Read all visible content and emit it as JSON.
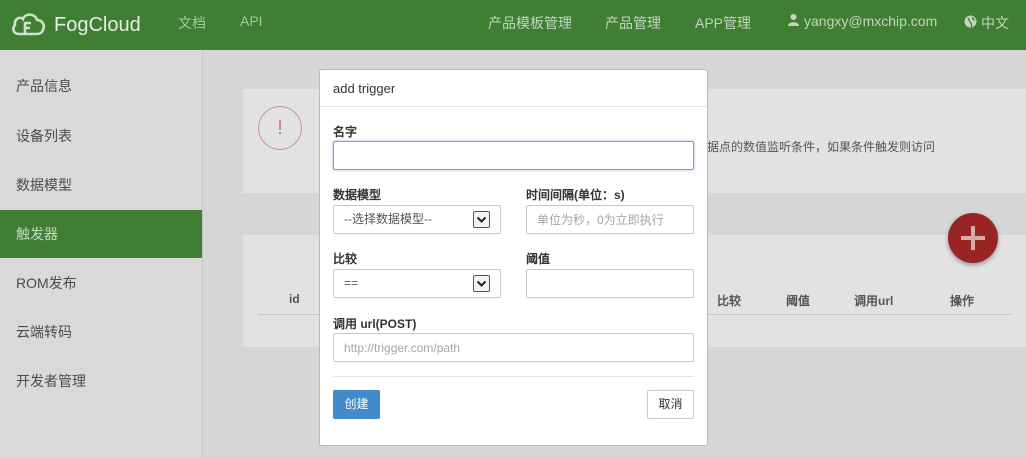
{
  "navbar": {
    "brand": "FogCloud",
    "links": [
      "文档",
      "API"
    ],
    "right_links": [
      "产品模板管理",
      "产品管理",
      "APP管理"
    ],
    "user": "yangxy@mxchip.com",
    "language": "中文"
  },
  "sidebar": {
    "items": [
      "产品信息",
      "设备列表",
      "数据模型",
      "触发器",
      "ROM发布",
      "云端转码",
      "开发者管理"
    ],
    "active_index": 3
  },
  "background": {
    "alert_icon": "!",
    "description_fragment": "据点的数值监听条件，如果条件触发则访问",
    "table_headers": [
      "id",
      "比较",
      "阈值",
      "调用url",
      "操作"
    ]
  },
  "modal": {
    "title": "add trigger",
    "name_label": "名字",
    "name_value": "",
    "model_label": "数据模型",
    "model_selected": "--选择数据模型--",
    "interval_label": "时间间隔(单位：s)",
    "interval_placeholder": "单位为秒，0为立即执行",
    "compare_label": "比较",
    "compare_selected": "==",
    "threshold_label": "阈值",
    "threshold_value": "",
    "url_label": "调用 url(POST)",
    "url_placeholder": "http://trigger.com/path",
    "create_button": "创建",
    "cancel_button": "取消"
  },
  "colors": {
    "navbar": "#3f7e33",
    "primary": "#428bca",
    "fab": "#9a2424"
  },
  "icons": [
    "fogcloud-logo-icon",
    "user-icon",
    "globe-icon",
    "alert-icon",
    "add-icon",
    "chevron-down-icon"
  ]
}
